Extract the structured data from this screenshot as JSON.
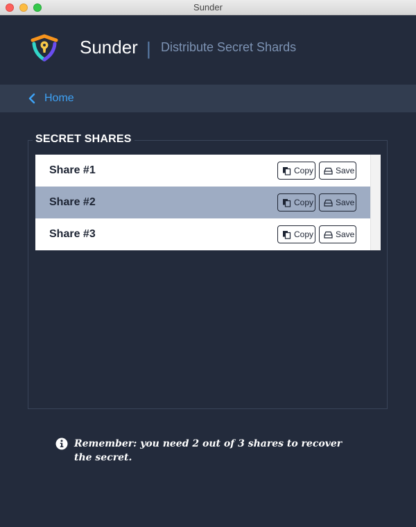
{
  "window": {
    "title": "Sunder"
  },
  "header": {
    "app_name": "Sunder",
    "separator": "|",
    "subtitle": "Distribute Secret Shards"
  },
  "nav": {
    "back_label": "Home"
  },
  "shares_panel": {
    "legend": "SECRET SHARES",
    "rows": [
      {
        "label": "Share #1",
        "copy_label": "Copy",
        "save_label": "Save",
        "selected": false
      },
      {
        "label": "Share #2",
        "copy_label": "Copy",
        "save_label": "Save",
        "selected": true
      },
      {
        "label": "Share #3",
        "copy_label": "Copy",
        "save_label": "Save",
        "selected": false
      }
    ]
  },
  "note": {
    "text": "Remember: you need 2 out of 3 shares to recover the secret."
  },
  "icons": {
    "logo": "shield-keyhole-icon",
    "back": "chevron-left-icon",
    "copy": "copy-icon",
    "save": "drive-icon",
    "info": "info-icon"
  },
  "colors": {
    "background": "#232b3c",
    "navbar": "#323d50",
    "accent": "#3ea2f5",
    "selected_row": "#9eacc3",
    "subtitle": "#7d93b4"
  }
}
